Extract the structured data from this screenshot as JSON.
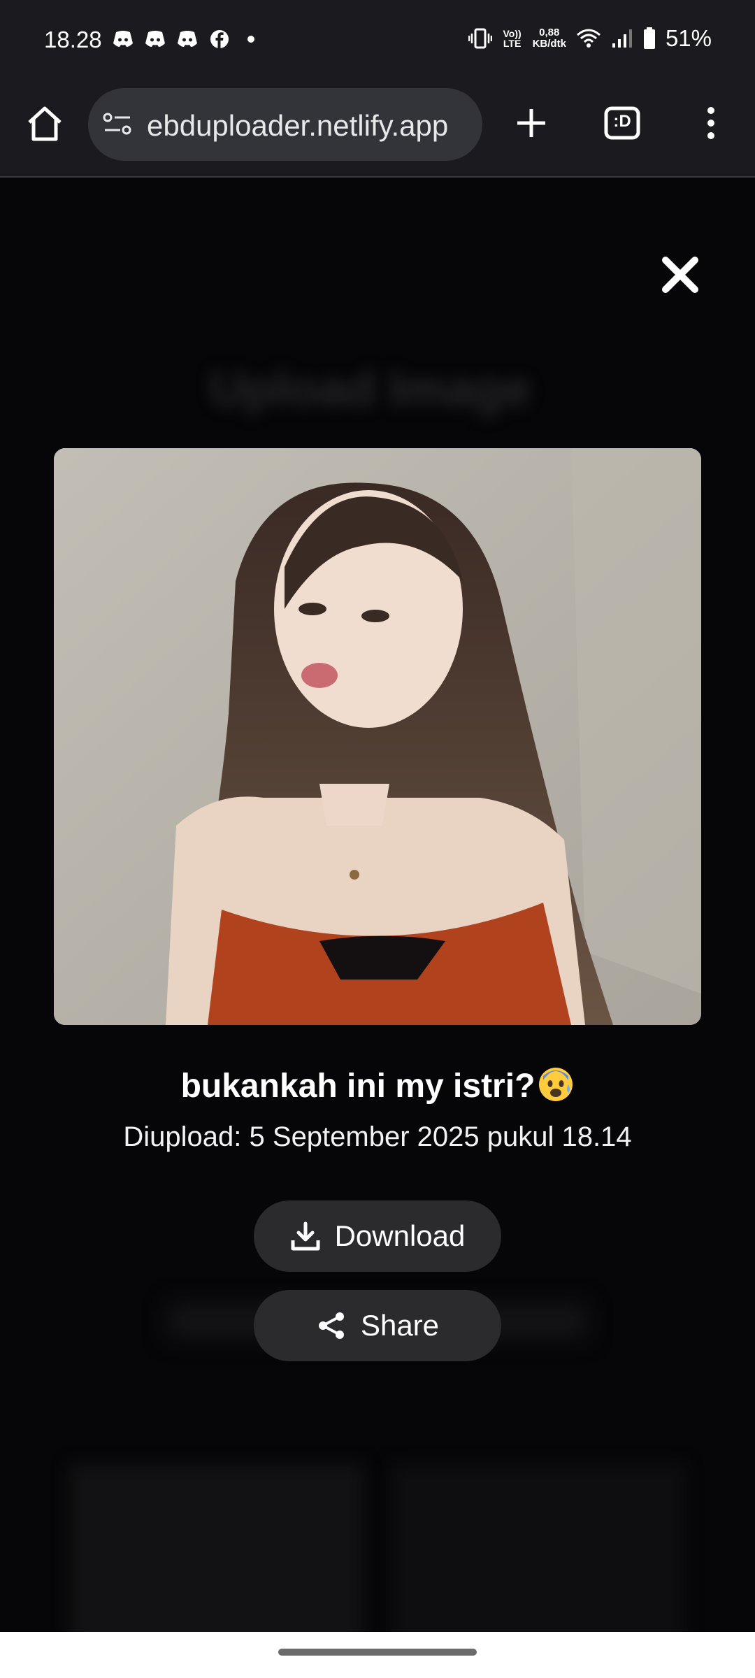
{
  "status_bar": {
    "time": "18.28",
    "network_volte": "Vo)) LTE",
    "speed_value": "0,88",
    "speed_unit": "KB/dtk",
    "battery": "51%"
  },
  "browser": {
    "url": "ebduploader.netlify.app",
    "tab_count": ":D"
  },
  "background_page": {
    "title": "Upload Image"
  },
  "modal": {
    "caption": "bukankah ini my istri?",
    "uploaded_text": "Diupload: 5 September 2025 pukul 18.14",
    "download_label": "Download",
    "share_label": "Share"
  },
  "colors": {
    "toolbar_bg": "#1b1b1f",
    "url_bar_bg": "#33343a",
    "page_bg": "#050506",
    "button_bg": "#2b2b2d"
  },
  "icons": [
    "home-icon",
    "site-settings-icon",
    "plus-icon",
    "tab-switcher-icon",
    "more-vert-icon",
    "close-icon",
    "download-icon",
    "share-icon",
    "anxious-face-emoji"
  ]
}
